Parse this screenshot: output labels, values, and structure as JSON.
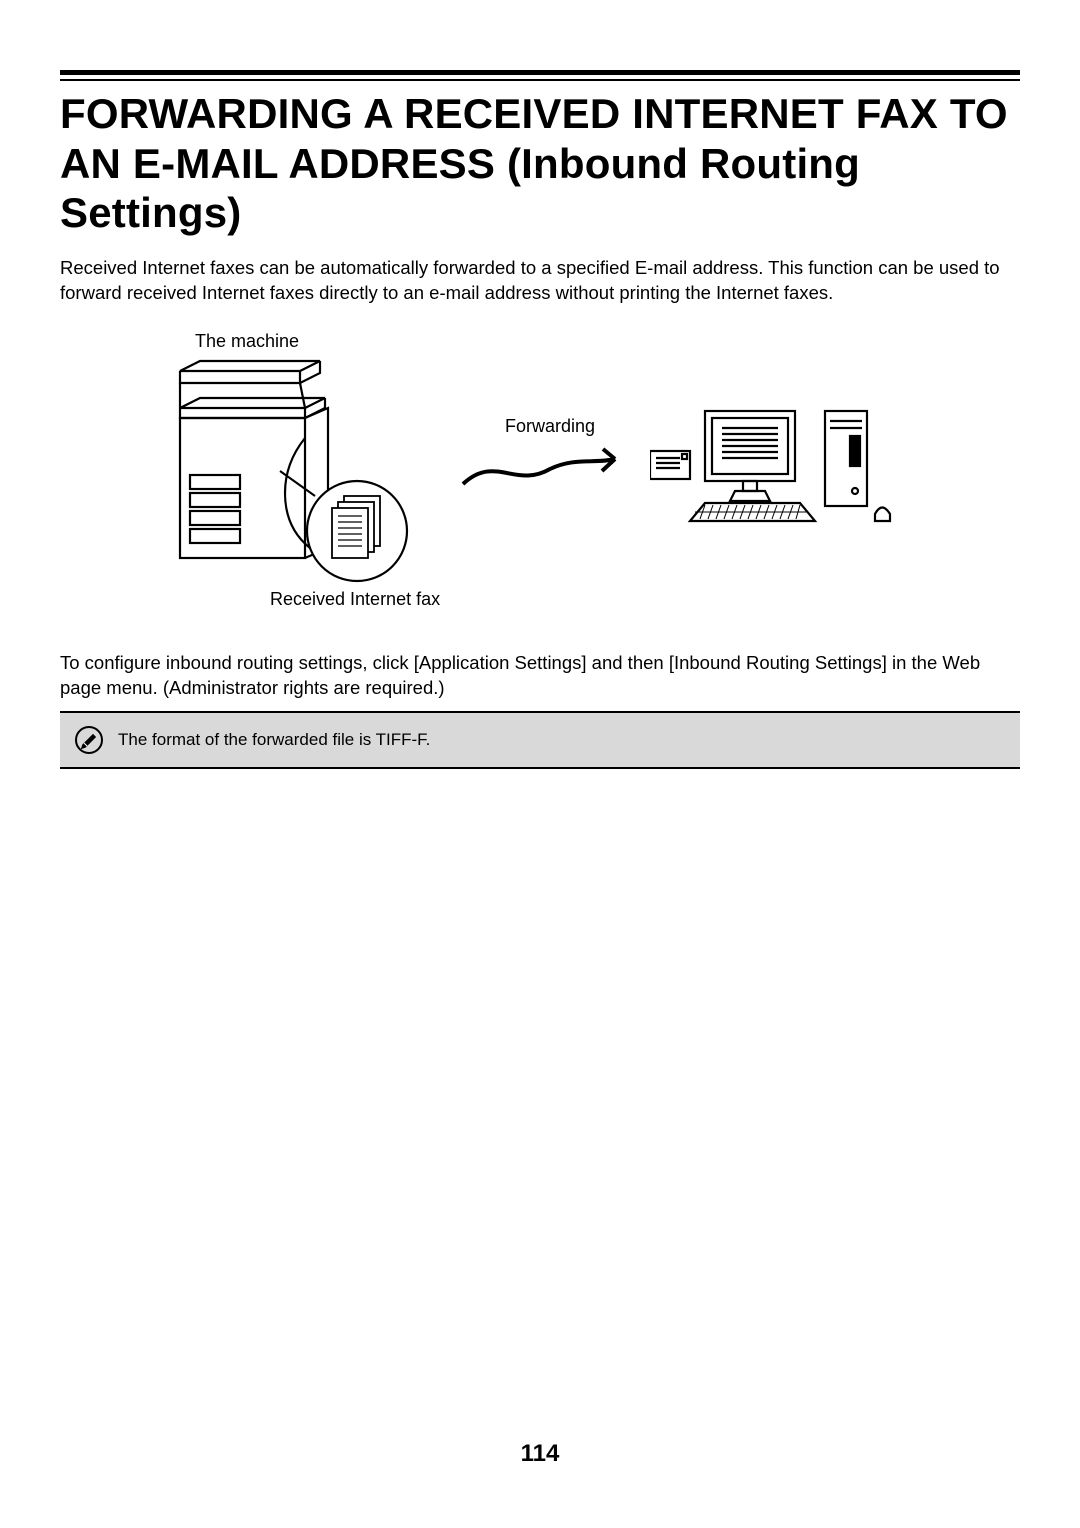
{
  "title": "FORWARDING A RECEIVED INTERNET FAX TO AN E-MAIL ADDRESS (Inbound Routing Settings)",
  "intro": "Received Internet faxes can be automatically forwarded to a specified E-mail address. This function can be used to forward received Internet faxes directly to an e-mail address without printing the Internet faxes.",
  "diagram": {
    "machine_label": "The machine",
    "forwarding_label": "Forwarding",
    "received_label": "Received Internet fax"
  },
  "config_text": "To configure inbound routing settings, click [Application Settings] and then [Inbound Routing Settings] in the Web page menu. (Administrator rights are required.)",
  "note_text": "The format of the forwarded file is TIFF-F.",
  "page_number": "114"
}
